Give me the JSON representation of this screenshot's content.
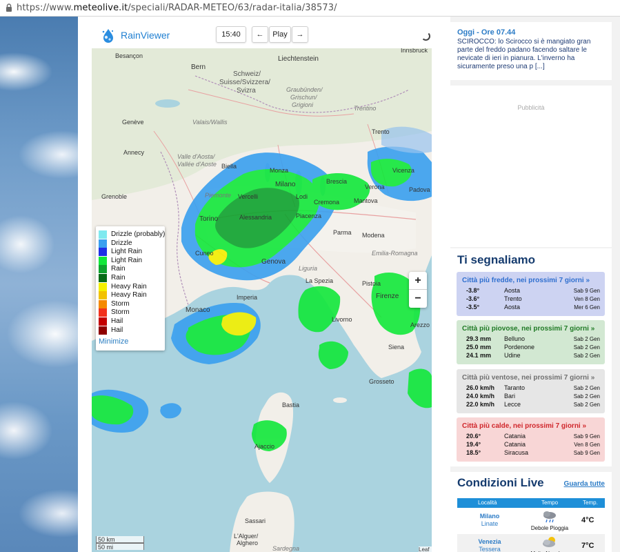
{
  "browser": {
    "url_prefix": "https://www.",
    "url_host": "meteolive.it",
    "url_path": "/speciali/RADAR-METEO/63/radar-italia/38573/"
  },
  "radar": {
    "brand": "RainViewer",
    "time": "15:40",
    "prev": "←",
    "play": "Play",
    "next": "→",
    "zoom_in": "+",
    "zoom_out": "−",
    "scale_km": "50 km",
    "scale_mi": "50 mi",
    "attribution": "Leaf",
    "legend": {
      "items": [
        {
          "label": "Drizzle (probably)",
          "color": "#7fe9ef"
        },
        {
          "label": "Drizzle",
          "color": "#3aa0ef"
        },
        {
          "label": "Light Rain",
          "color": "#1f2fe6"
        },
        {
          "label": "Light Rain",
          "color": "#12e83a"
        },
        {
          "label": "Rain",
          "color": "#0ea32e"
        },
        {
          "label": "Rain",
          "color": "#066b16"
        },
        {
          "label": "Heavy Rain",
          "color": "#f4f000"
        },
        {
          "label": "Heavy Rain",
          "color": "#f2c200"
        },
        {
          "label": "Storm",
          "color": "#f58a00"
        },
        {
          "label": "Storm",
          "color": "#f2321d"
        },
        {
          "label": "Hail",
          "color": "#c40000"
        },
        {
          "label": "Hail",
          "color": "#8f0000"
        }
      ],
      "minimize": "Minimize"
    },
    "places": {
      "besancon": "Besançon",
      "bern": "Bern",
      "schweiz": "Schweiz/",
      "suisse": "Suisse/Svizzera/",
      "svizra": "Svizra",
      "liechtenstein": "Liechtenstein",
      "innsbruck": "Innsbruck",
      "graubunden": "Graubünden/",
      "grischun": "Grischun/",
      "grigioni": "Grigioni",
      "valais": "Valais/Wallis",
      "geneve": "Genève",
      "annecy": "Annecy",
      "valle": "Valle d'Aosta/",
      "vallee": "Vallée d'Aoste",
      "biella": "Biella",
      "monza": "Monza",
      "milano": "Milano",
      "brescia": "Brescia",
      "verona": "Verona",
      "vicenza": "Vicenza",
      "padova": "Padova",
      "trento": "Trento",
      "trentino": "Trentino",
      "grenoble": "Grenoble",
      "piemonte": "Piemonte",
      "vercelli": "Vercelli",
      "lodi": "Lodi",
      "cremona": "Cremona",
      "mantova": "Mantova",
      "torino": "Torino",
      "alessandria": "Alessandria",
      "piacenza": "Piacenza",
      "parma": "Parma",
      "modena": "Modena",
      "emilia": "Emilia-Romagna",
      "cuneo": "Cuneo",
      "genova": "Genova",
      "liguria": "Liguria",
      "laspezia": "La Spezia",
      "pistoia": "Pistoia",
      "firenze": "Firenze",
      "imperia": "Imperia",
      "monaco": "Monaco",
      "livorno": "Livorno",
      "arezzo": "Arezzo",
      "siena": "Siena",
      "grosseto": "Grosseto",
      "bastia": "Bastia",
      "ajaccio": "Ajaccio",
      "sassari": "Sassari",
      "alghero": "L'Alguer/",
      "alghero2": "Alghero",
      "sardegna": "Sardegna"
    }
  },
  "news": {
    "title": "Oggi - Ore 07.44",
    "body": "SCIROCCO: lo Scirocco si è mangiato gran parte del freddo padano facendo saltare le nevicate di ieri in pianura. L'inverno ha sicuramente preso una p [...]"
  },
  "ad_label": "Pubblicità",
  "segnaliamo": {
    "heading": "Ti segnaliamo",
    "cards": [
      {
        "title": "Città più fredde, nei prossimi 7 giorni »",
        "bg": "#cdd3f2",
        "title_color": "#2f6fcf",
        "rows": [
          {
            "value": "-3.8°",
            "city": "Aosta",
            "date": "Sab 9 Gen"
          },
          {
            "value": "-3.6°",
            "city": "Trento",
            "date": "Ven 8 Gen"
          },
          {
            "value": "-3.5°",
            "city": "Aosta",
            "date": "Mer 6 Gen"
          }
        ]
      },
      {
        "title": "Città più piovose, nei prossimi 7 giorni »",
        "bg": "#d2e8d2",
        "title_color": "#1f7a25",
        "rows": [
          {
            "value": "29.3 mm",
            "city": "Belluno",
            "date": "Sab 2 Gen"
          },
          {
            "value": "25.0 mm",
            "city": "Pordenone",
            "date": "Sab 2 Gen"
          },
          {
            "value": "24.1 mm",
            "city": "Udine",
            "date": "Sab 2 Gen"
          }
        ]
      },
      {
        "title": "Città più ventose, nei prossimi 7 giorni »",
        "bg": "#e6e6e6",
        "title_color": "#6f6f6f",
        "rows": [
          {
            "value": "26.0 km/h",
            "city": "Taranto",
            "date": "Sab 2 Gen"
          },
          {
            "value": "24.0 km/h",
            "city": "Bari",
            "date": "Sab 2 Gen"
          },
          {
            "value": "22.0 km/h",
            "city": "Lecce",
            "date": "Sab 2 Gen"
          }
        ]
      },
      {
        "title": "Città più calde, nei prossimi 7 giorni »",
        "bg": "#f8d6d6",
        "title_color": "#d0262b",
        "rows": [
          {
            "value": "20.6°",
            "city": "Catania",
            "date": "Sab 9 Gen"
          },
          {
            "value": "19.4°",
            "city": "Catania",
            "date": "Ven 8 Gen"
          },
          {
            "value": "18.5°",
            "city": "Siracusa",
            "date": "Sab 9 Gen"
          }
        ]
      }
    ]
  },
  "condizioni": {
    "heading": "Condizioni Live",
    "link": "Guarda tutte",
    "columns": {
      "loc": "Località",
      "wx": "Tempo",
      "temp": "Temp."
    },
    "rows": [
      {
        "city": "Milano",
        "station": "Linate",
        "weather": "Debole Pioggia",
        "temp": "4°C",
        "icon": "rain-cloud-icon"
      },
      {
        "city": "Venezia",
        "station": "Tessera",
        "weather": "Molto Nuvoloso",
        "temp": "7°C",
        "icon": "partly-cloudy-icon"
      }
    ]
  }
}
